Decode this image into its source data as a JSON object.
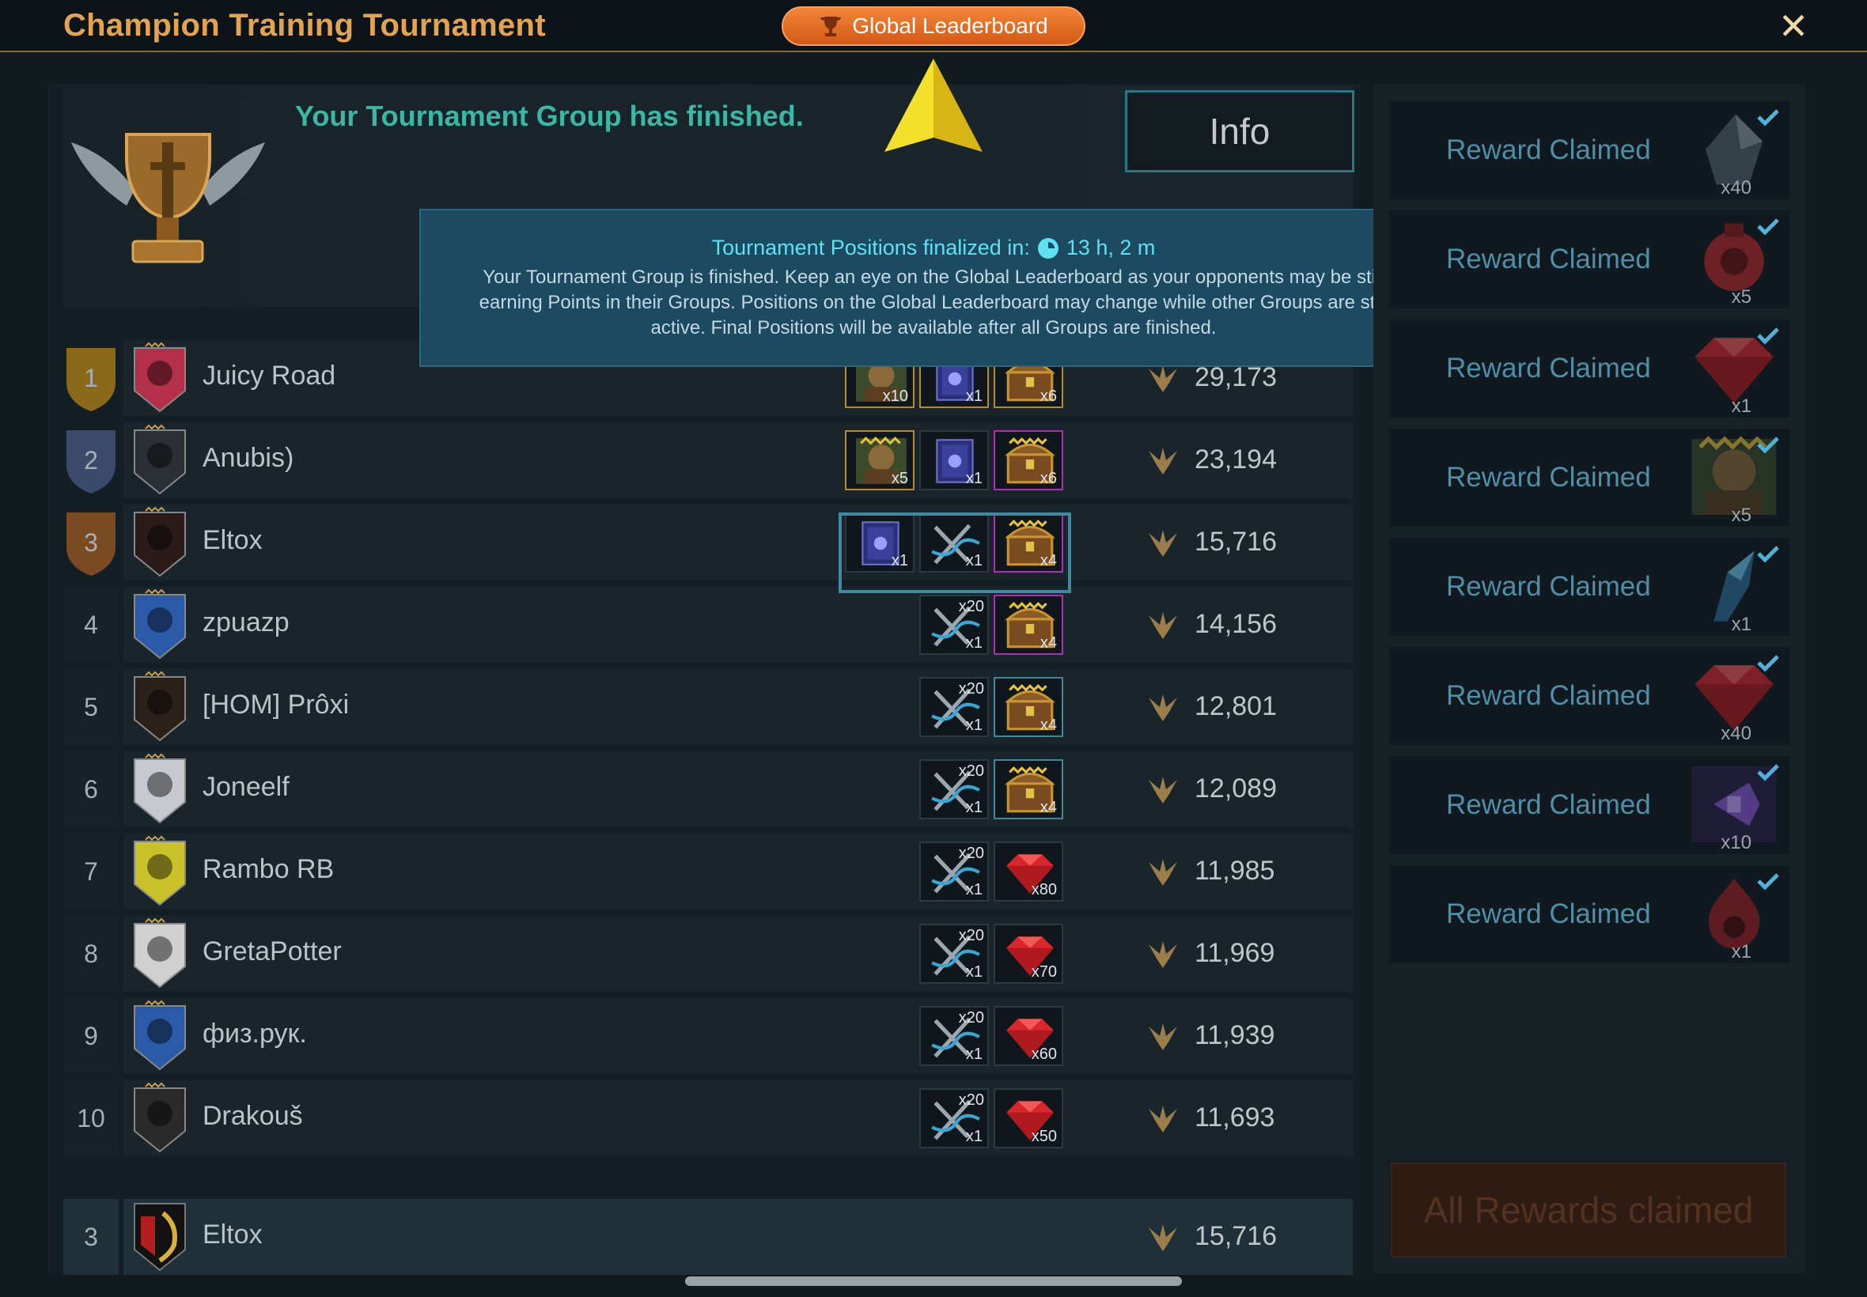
{
  "window": {
    "title": "Champion Training Tournament",
    "leaderboard_button": "Global Leaderboard",
    "close_label": "✕"
  },
  "header": {
    "status_text": "Your Tournament Group has finished.",
    "info_button": "Info"
  },
  "tooltip": {
    "title": "Tournament Positions finalized in:",
    "countdown": "13 h, 2 m",
    "body": "Your Tournament Group is finished. Keep an eye on the Global Leaderboard as your opponents may be still earning Points in their Groups. Positions on the Global Leaderboard may change while other Groups are still active. Final Positions will be available after all Groups are finished."
  },
  "leaderboard": [
    {
      "rank": "1",
      "name": "Juicy Road",
      "points": "29,173",
      "rewards": [
        {
          "icon": "champion-portrait-icon",
          "qty": "x10",
          "frame": "gold"
        },
        {
          "icon": "tome-book-icon",
          "qty": "x1",
          "frame": "gold"
        },
        {
          "icon": "treasure-chest-icon",
          "qty": "x6",
          "frame": "gold"
        }
      ]
    },
    {
      "rank": "2",
      "name": "Anubis)",
      "points": "23,194",
      "rewards": [
        {
          "icon": "champion-portrait-icon",
          "qty": "x5",
          "frame": "gold"
        },
        {
          "icon": "tome-book-icon",
          "qty": "x1",
          "frame": "plain"
        },
        {
          "icon": "treasure-chest-icon",
          "qty": "x6",
          "frame": "purple"
        }
      ]
    },
    {
      "rank": "3",
      "name": "Eltox",
      "points": "15,716",
      "rewards": [
        {
          "icon": "tome-book-icon",
          "qty": "x1",
          "frame": "plain"
        },
        {
          "icon": "crossed-swords-icon",
          "qty": "x1",
          "frame": "plain"
        },
        {
          "icon": "treasure-chest-icon",
          "qty": "x4",
          "frame": "purple"
        }
      ]
    },
    {
      "rank": "4",
      "name": "zpuazp",
      "points": "14,156",
      "rewards": [
        {
          "icon": "crossed-swords-icon",
          "qty": "x1",
          "qty_top": "x20",
          "frame": "plain"
        },
        {
          "icon": "treasure-chest-icon",
          "qty": "x4",
          "frame": "purple"
        }
      ]
    },
    {
      "rank": "5",
      "name": "[HOM] Prôxi",
      "points": "12,801",
      "rewards": [
        {
          "icon": "crossed-swords-icon",
          "qty": "x1",
          "qty_top": "x20",
          "frame": "plain"
        },
        {
          "icon": "treasure-chest-icon",
          "qty": "x4",
          "frame": "teal"
        }
      ]
    },
    {
      "rank": "6",
      "name": "Joneelf",
      "points": "12,089",
      "rewards": [
        {
          "icon": "crossed-swords-icon",
          "qty": "x1",
          "qty_top": "x20",
          "frame": "plain"
        },
        {
          "icon": "treasure-chest-icon",
          "qty": "x4",
          "frame": "teal"
        }
      ]
    },
    {
      "rank": "7",
      "name": "Rambo RB",
      "points": "11,985",
      "rewards": [
        {
          "icon": "crossed-swords-icon",
          "qty": "x1",
          "qty_top": "x20",
          "frame": "plain"
        },
        {
          "icon": "ruby-gem-icon",
          "qty": "x80",
          "frame": "plain"
        }
      ]
    },
    {
      "rank": "8",
      "name": "GretaPotter",
      "points": "11,969",
      "rewards": [
        {
          "icon": "crossed-swords-icon",
          "qty": "x1",
          "qty_top": "x20",
          "frame": "plain"
        },
        {
          "icon": "ruby-gem-icon",
          "qty": "x70",
          "frame": "plain"
        }
      ]
    },
    {
      "rank": "9",
      "name": "физ.рук.",
      "points": "11,939",
      "rewards": [
        {
          "icon": "crossed-swords-icon",
          "qty": "x1",
          "qty_top": "x20",
          "frame": "plain"
        },
        {
          "icon": "ruby-gem-icon",
          "qty": "x60",
          "frame": "plain"
        }
      ]
    },
    {
      "rank": "10",
      "name": "Drakouš",
      "points": "11,693",
      "rewards": [
        {
          "icon": "crossed-swords-icon",
          "qty": "x1",
          "qty_top": "x20",
          "frame": "plain"
        },
        {
          "icon": "ruby-gem-icon",
          "qty": "x50",
          "frame": "plain"
        }
      ]
    }
  ],
  "my_position": {
    "rank": "3",
    "name": "Eltox",
    "points": "15,716"
  },
  "claimed_rewards": [
    {
      "label": "Reward Claimed",
      "icon": "crystal-shard-icon",
      "qty": "x40"
    },
    {
      "label": "Reward Claimed",
      "icon": "red-potion-icon",
      "qty": "x5"
    },
    {
      "label": "Reward Claimed",
      "icon": "ruby-gem-icon",
      "qty": "x1"
    },
    {
      "label": "Reward Claimed",
      "icon": "champion-portrait-icon",
      "qty": "x5"
    },
    {
      "label": "Reward Claimed",
      "icon": "blue-crystal-icon",
      "qty": "x1"
    },
    {
      "label": "Reward Claimed",
      "icon": "ruby-gem-icon",
      "qty": "x40"
    },
    {
      "label": "Reward Claimed",
      "icon": "purple-shard-icon",
      "qty": "x10"
    },
    {
      "label": "Reward Claimed",
      "icon": "red-flame-icon",
      "qty": "x1"
    }
  ],
  "all_rewards_button": "All Rewards claimed",
  "colors": {
    "accent": "#e2a451",
    "button_orange": "#e26f27",
    "teal_text": "#3bb7a6",
    "tooltip_bg": "#1c4a60",
    "gold_frame": "#b98a2a",
    "purple_frame": "#b02eb4"
  }
}
